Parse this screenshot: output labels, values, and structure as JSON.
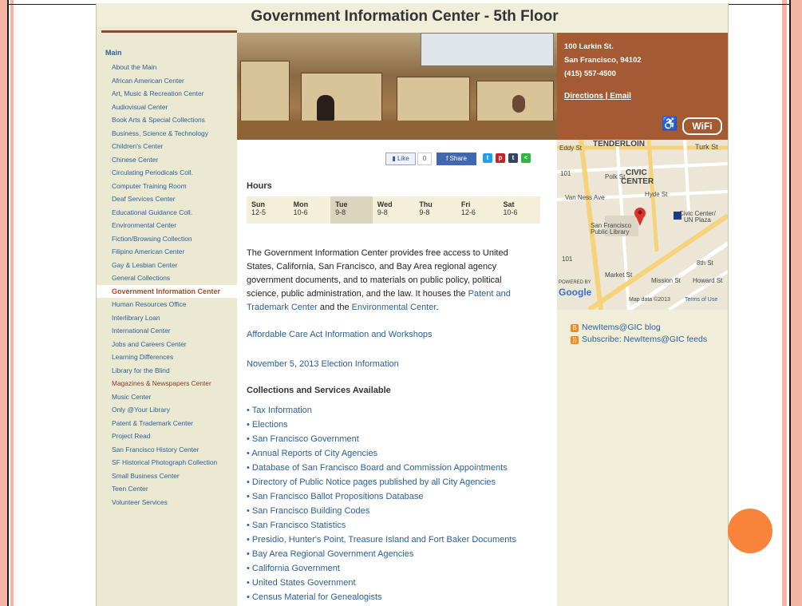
{
  "page": {
    "title": "Government Information Center - 5th Floor"
  },
  "sidebar": {
    "heading": "Main",
    "items": [
      "About the Main",
      "African American Center",
      "Art, Music & Recreation Center",
      "Audiovisual Center",
      "Book Arts & Special Collections",
      "Business, Science & Technology",
      "Children's Center",
      "Chinese Center",
      "Circulating Periodicals Coll.",
      "Computer Training Room",
      "Deaf Services Center",
      "Educational Guidance Coll.",
      "Environmental Center",
      "Fiction/Browsing Collection",
      "Filipino American Center",
      "Gay & Lesbian Center",
      "General Collections",
      "Government Information Center",
      "Human Resources Office",
      "Interlibrary Loan",
      "International Center",
      "Jobs and Careers Center",
      "Learning Differences",
      "Library for the Blind",
      "Magazines & Newspapers Center",
      "Music Center",
      "Only @Your Library",
      "Patent & Trademark Center",
      "Project Read",
      "San Francisco History Center",
      "SF Historical Photograph Collection",
      "Small Business Center",
      "Teen Center",
      "Volunteer Services"
    ],
    "active_item": "Government Information Center"
  },
  "social": {
    "like_label": "Like",
    "like_count": "0",
    "share_label": "Share",
    "icons": [
      "twitter-icon",
      "pinterest-icon",
      "tumblr-icon",
      "share-icon"
    ]
  },
  "hours": {
    "label": "Hours",
    "days": [
      {
        "day": "Sun",
        "time": "12-5"
      },
      {
        "day": "Mon",
        "time": "10-6"
      },
      {
        "day": "Tue",
        "time": "9-8"
      },
      {
        "day": "Wed",
        "time": "9-8"
      },
      {
        "day": "Thu",
        "time": "9-8"
      },
      {
        "day": "Fri",
        "time": "12-6"
      },
      {
        "day": "Sat",
        "time": "10-6"
      }
    ]
  },
  "intro": {
    "text_before": "The Government Information Center provides free access to United States, California, San Francisco, and Bay Area regional agency government documents, and to materials on public policy, political science, public administration, and the law. It houses the ",
    "link1": "Patent and Trademark Center",
    "text_mid": " and the ",
    "link2": "Environmental Center",
    "text_after": "."
  },
  "links": {
    "aca": "Affordable Care Act Information and Workshops",
    "election": "November 5, 2013 Election Information"
  },
  "collections": {
    "heading": "Collections and Services Available",
    "items": [
      "Tax Information",
      "Elections",
      "San Francisco Government",
      "Annual Reports of City Agencies",
      "Database of San Francisco Board and Commission Appointments",
      "Directory of Public Notice pages published by all City Agencies",
      "San Francisco Ballot Propositions Database",
      "San Francisco Building Codes",
      "San Francisco Statistics",
      "Presidio, Hunter's Point, Treasure Island and Fort Baker Documents",
      "Bay Area Regional Government Agencies",
      "California Government",
      "United States Government",
      "Census Material for Genealogists"
    ]
  },
  "info": {
    "address1": "100 Larkin St.",
    "address2": "San Francisco, 94102",
    "phone": "(415) 557-4500",
    "directions": "Directions",
    "separator": " | ",
    "email": "Email",
    "wifi": "WiFi"
  },
  "map": {
    "labels": [
      "TENDERLOIN",
      "CIVIC",
      "CENTER",
      "Eddy St",
      "Turk St",
      "Van Ness Ave",
      "Polk St",
      "Hyde St",
      "San Francisco",
      "Public Library",
      "Civic Center/",
      "UN Plaza",
      "Market St",
      "Mission St",
      "8th St",
      "Howard St",
      "POWERED BY",
      "Google",
      "Map data ©2013",
      "Terms of Use",
      "101",
      "101"
    ]
  },
  "blog": {
    "line1": "NewItems@GIC blog",
    "line2": "Subscribe: NewItems@GIC feeds"
  },
  "colors": {
    "accent": "#a45a32",
    "link": "#2a5f9a",
    "sidebar_bg": "#ece9d2",
    "slide_frame": "#f4b5a3",
    "dot": "#f7843a"
  }
}
